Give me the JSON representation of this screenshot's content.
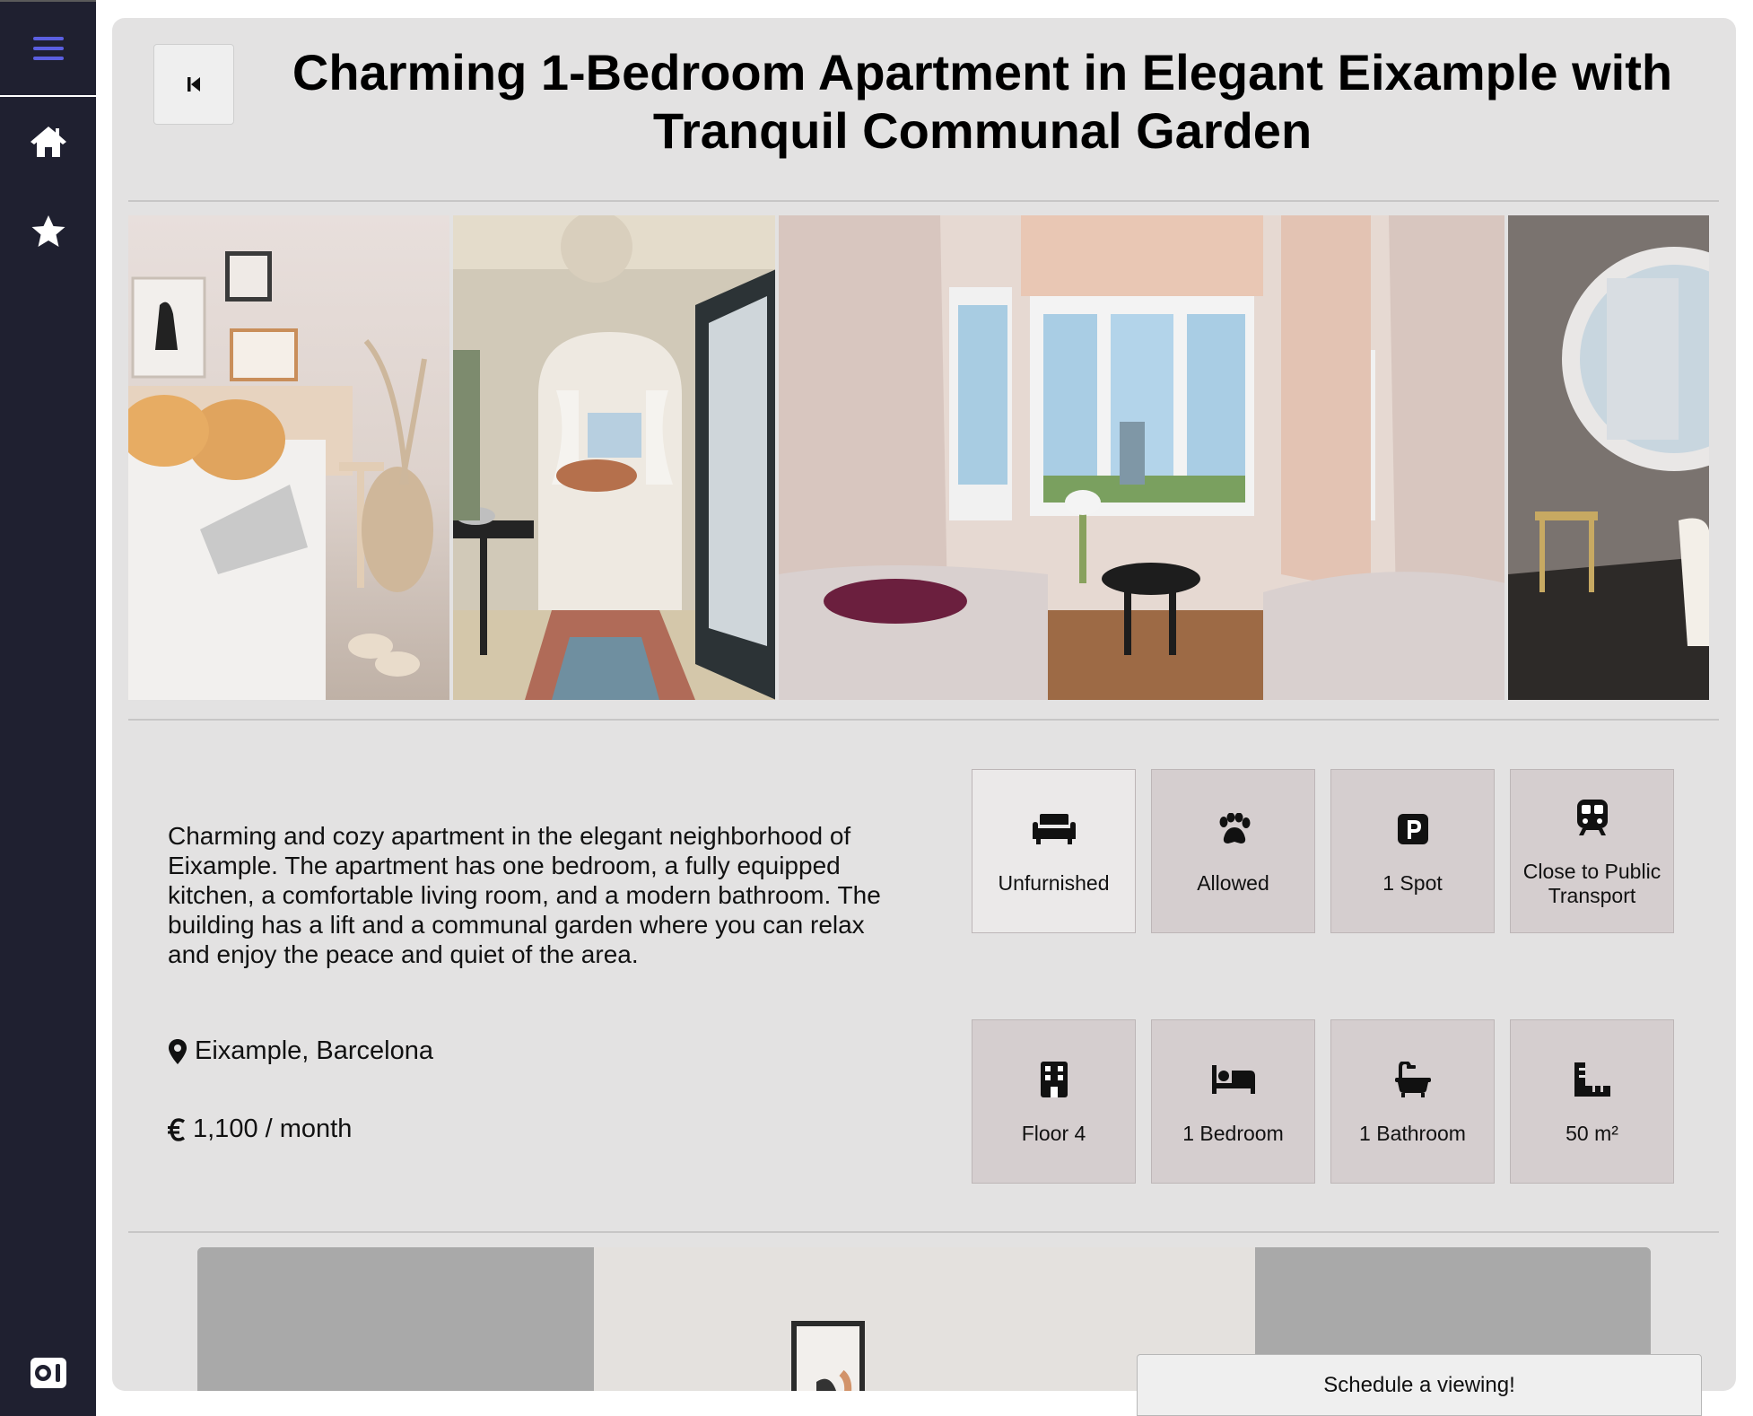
{
  "sidebar": {
    "items": [
      {
        "icon": "hamburger-icon"
      },
      {
        "icon": "home-icon"
      },
      {
        "icon": "star-icon"
      },
      {
        "icon": "radio-icon"
      }
    ],
    "accent": "#5b5fe0"
  },
  "listing": {
    "title": "Charming 1-Bedroom Apartment in Elegant Eixample with Tranquil Communal Garden",
    "description": "Charming and cozy apartment in the elegant neighborhood of Eixample. The apartment has one bedroom, a fully equipped kitchen, a comfortable living room, and a modern bathroom. The building has a lift and a communal garden where you can relax and enjoy the peace and quiet of the area.",
    "location": "Eixample, Barcelona",
    "price": "1,100 / month"
  },
  "features": [
    {
      "icon": "sofa-icon",
      "label": "Unfurnished"
    },
    {
      "icon": "paw-icon",
      "label": "Allowed"
    },
    {
      "icon": "parking-icon",
      "label": "1 Spot"
    },
    {
      "icon": "train-icon",
      "label": "Close to Public Transport"
    },
    {
      "icon": "building-icon",
      "label": "Floor 4"
    },
    {
      "icon": "bed-icon",
      "label": "1 Bedroom"
    },
    {
      "icon": "bath-icon",
      "label": "1 Bathroom"
    },
    {
      "icon": "ruler-icon",
      "label": "50 m²"
    }
  ],
  "gallery": [
    "bedroom-photo",
    "hallway-bathroom-photo",
    "living-room-photo",
    "round-window-photo"
  ],
  "cta": {
    "label": "Schedule a viewing!"
  }
}
